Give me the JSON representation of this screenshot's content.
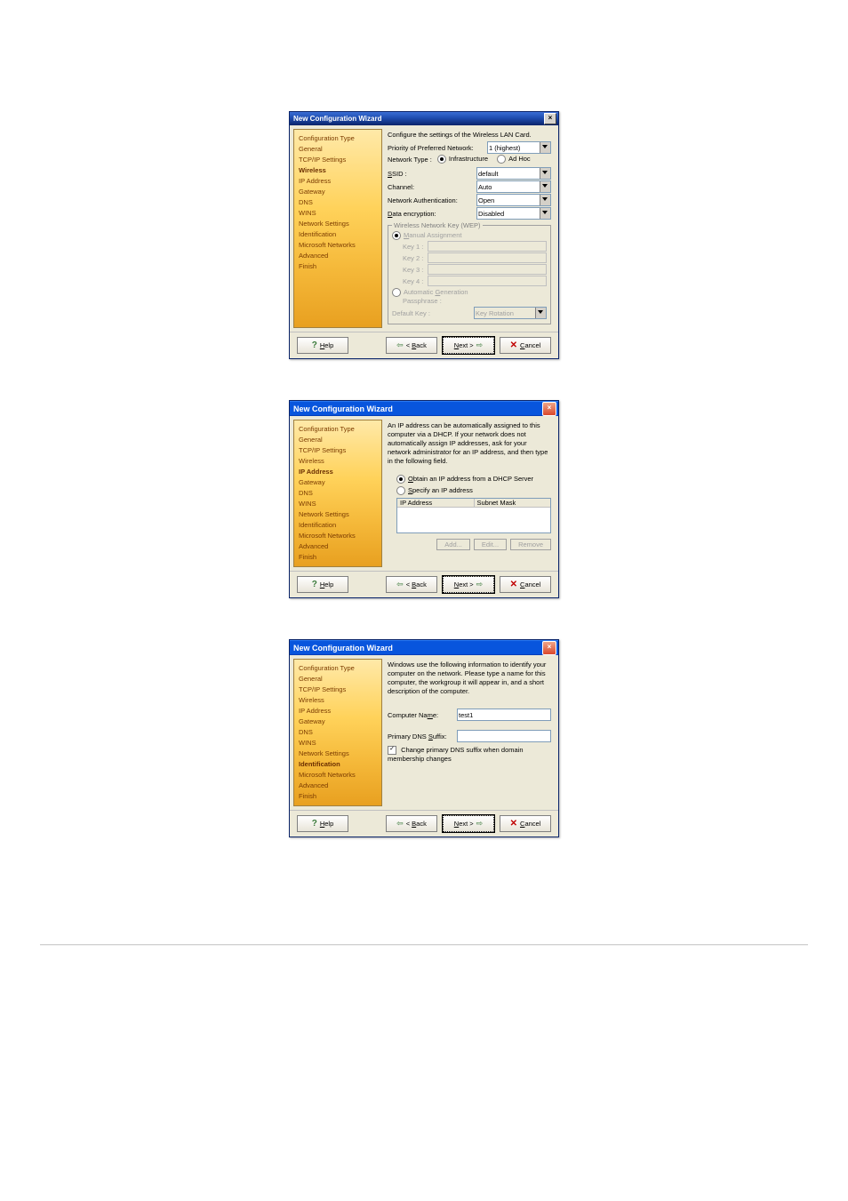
{
  "dialogs": [
    {
      "title": "New Configuration Wizard",
      "style": "classic",
      "sidebar": [
        "Configuration Type",
        "General",
        "TCP/IP Settings",
        "Wireless",
        "IP Address",
        "Gateway",
        "DNS",
        "WINS",
        "Network Settings",
        "Identification",
        "Microsoft Networks",
        "Advanced",
        "Finish"
      ],
      "selected_index": 3,
      "heading": "Configure the settings of the Wireless LAN Card.",
      "priority_label": "Priority of Preferred Network:",
      "priority_value": "1 (highest)",
      "network_type_label": "Network Type :",
      "network_type_opt1": "Infrastructure",
      "network_type_opt2": "Ad Hoc",
      "ssid_label": "SSID :",
      "ssid_value": "default",
      "channel_label": "Channel:",
      "channel_value": "Auto",
      "auth_label": "Network Authentication:",
      "auth_value": "Open",
      "enc_label": "Data encryption:",
      "enc_value": "Disabled",
      "wep_legend": "Wireless Network Key (WEP)",
      "manual_label": "Manual Assignment",
      "keys": [
        "Key 1 :",
        "Key 2 :",
        "Key 3 :",
        "Key 4 :"
      ],
      "autogen_label": "Automatic Generation",
      "passphrase_label": "Passphrase :",
      "default_key_label": "Default Key :",
      "key_rotation_value": "Key Rotation",
      "btn_help": "Help",
      "btn_back": "< Back",
      "btn_next": "Next >",
      "btn_cancel": "Cancel"
    },
    {
      "title": "New Configuration Wizard",
      "style": "xp",
      "sidebar": [
        "Configuration Type",
        "General",
        "TCP/IP Settings",
        "Wireless",
        "IP Address",
        "Gateway",
        "DNS",
        "WINS",
        "Network Settings",
        "Identification",
        "Microsoft Networks",
        "Advanced",
        "Finish"
      ],
      "selected_index": 4,
      "heading": "An IP address can be automatically assigned to this computer via a DHCP. If your network does not automatically assign IP addresses, ask for your network administrator for an IP address, and then type in the following field.",
      "opt_dhcp": "Obtain an IP address from a DHCP Server",
      "opt_static": "Specify an IP address",
      "col_ip": "IP Address",
      "col_mask": "Subnet Mask",
      "btn_add": "Add...",
      "btn_edit": "Edit...",
      "btn_remove": "Remove",
      "btn_help": "Help",
      "btn_back": "< Back",
      "btn_next": "Next >",
      "btn_cancel": "Cancel"
    },
    {
      "title": "New Configuration Wizard",
      "style": "xp",
      "sidebar": [
        "Configuration Type",
        "General",
        "TCP/IP Settings",
        "Wireless",
        "IP Address",
        "Gateway",
        "DNS",
        "WINS",
        "Network Settings",
        "Identification",
        "Microsoft Networks",
        "Advanced",
        "Finish"
      ],
      "selected_index": 9,
      "heading": "Windows use the following information to identify your computer on the network. Please type a name for this computer, the workgroup it will appear in, and a short description of the computer.",
      "computer_name_label": "Computer Name:",
      "computer_name_value": "test1",
      "dns_suffix_label": "Primary DNS Suffix:",
      "dns_suffix_value": "",
      "chk_change_dns": "Change primary DNS suffix when domain membership changes",
      "btn_help": "Help",
      "btn_back": "< Back",
      "btn_next": "Next >",
      "btn_cancel": "Cancel"
    }
  ]
}
